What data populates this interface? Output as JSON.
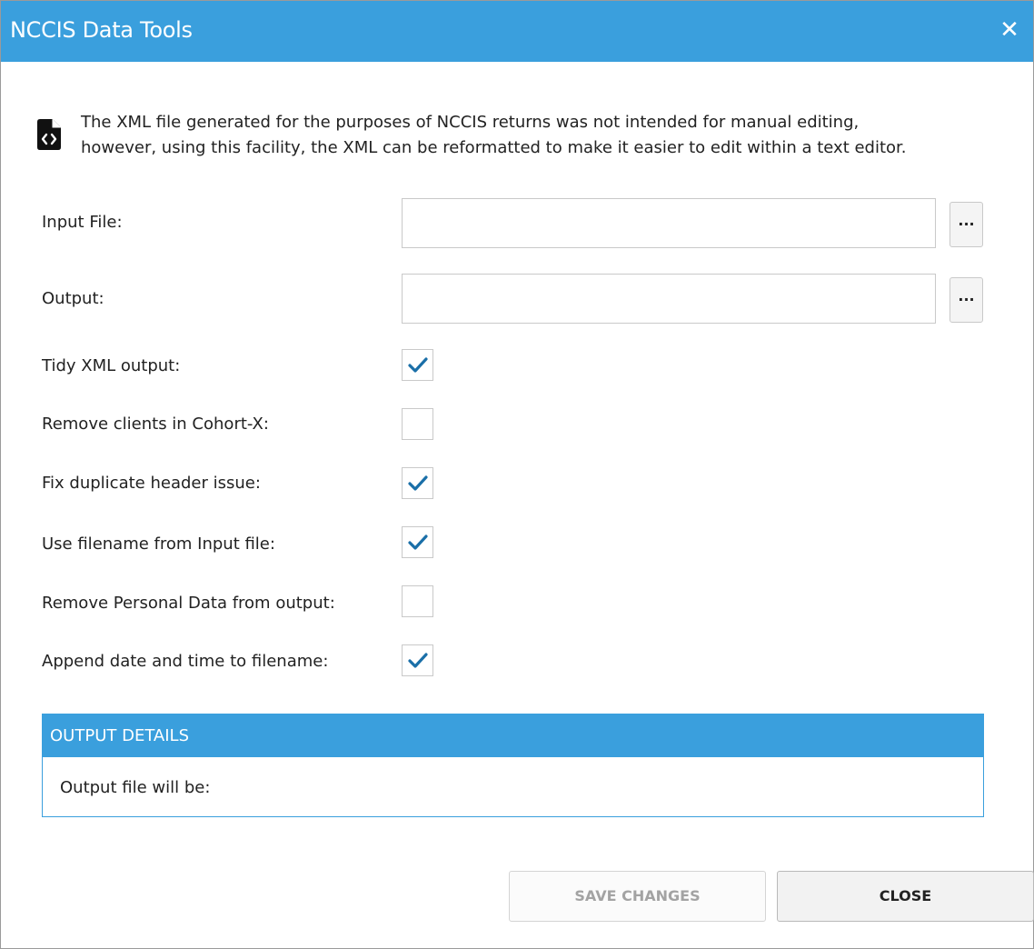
{
  "window": {
    "title": "NCCIS Data Tools",
    "close_glyph": "✕"
  },
  "info": {
    "icon": "file-code-icon",
    "line1": "The XML file generated for the purposes of NCCIS returns was not intended for manual editing,",
    "line2": "however, using this facility, the XML can be reformatted to make it easier to edit within a text editor."
  },
  "form": {
    "input_file": {
      "label": "Input File:",
      "value": "",
      "browse_label": "..."
    },
    "output": {
      "label": "Output:",
      "value": "",
      "browse_label": "..."
    },
    "options": [
      {
        "label": "Tidy XML output:",
        "checked": true
      },
      {
        "label": "Remove clients in Cohort-X:",
        "checked": false
      },
      {
        "label": "Fix duplicate header issue:",
        "checked": true
      },
      {
        "label": "Use filename from Input file:",
        "checked": true
      },
      {
        "label": "Remove Personal Data from output:",
        "checked": false
      },
      {
        "label": "Append date and time to filename:",
        "checked": true
      }
    ]
  },
  "output_details": {
    "header": "OUTPUT DETAILS",
    "body": "Output file will be:"
  },
  "buttons": {
    "save": "SAVE CHANGES",
    "save_enabled": false,
    "close": "CLOSE"
  },
  "colors": {
    "accent": "#3a9fdd",
    "check": "#1a6fa8"
  }
}
